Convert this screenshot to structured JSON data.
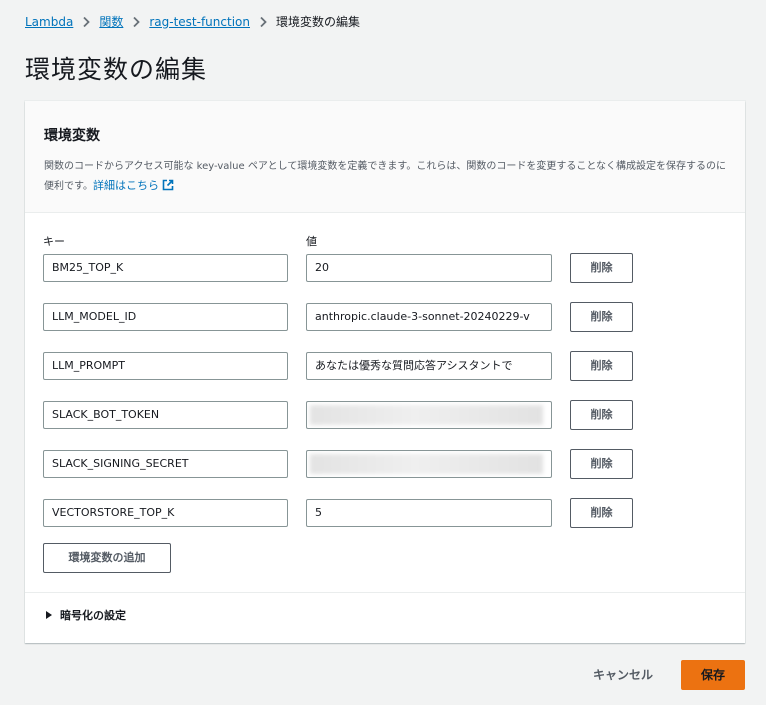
{
  "breadcrumb": {
    "items": [
      {
        "label": "Lambda",
        "link": true
      },
      {
        "label": "関数",
        "link": true
      },
      {
        "label": "rag-test-function",
        "link": true
      },
      {
        "label": "環境変数の編集",
        "link": false
      }
    ],
    "separator_icon": "chevron-right-icon"
  },
  "page": {
    "title": "環境変数の編集"
  },
  "panel": {
    "title": "環境変数",
    "description": "関数のコードからアクセス可能な key-value ペアとして環境変数を定義できます。これらは、関数のコードを変更することなく構成設定を保存するのに便利です。",
    "detail_link": "詳細はこちら",
    "detail_icon": "external-link-icon",
    "key_header": "キー",
    "value_header": "値"
  },
  "variables": [
    {
      "key": "BM25_TOP_K",
      "value": "20",
      "masked": false
    },
    {
      "key": "LLM_MODEL_ID",
      "value": "anthropic.claude-3-sonnet-20240229-v",
      "masked": false
    },
    {
      "key": "LLM_PROMPT",
      "value": "あなたは優秀な質問応答アシスタントで",
      "masked": false
    },
    {
      "key": "SLACK_BOT_TOKEN",
      "value": "",
      "masked": true
    },
    {
      "key": "SLACK_SIGNING_SECRET",
      "value": "",
      "masked": true
    },
    {
      "key": "VECTORSTORE_TOP_K",
      "value": "5",
      "masked": false
    }
  ],
  "delete_label": "削除",
  "add_label": "環境変数の追加",
  "encryption": {
    "label": "暗号化の設定",
    "icon": "caret-right-icon"
  },
  "footer": {
    "cancel_label": "キャンセル",
    "save_label": "保存"
  },
  "colors": {
    "link": "#0073bb",
    "primary_button": "#ec7211",
    "background": "#f2f3f3"
  }
}
